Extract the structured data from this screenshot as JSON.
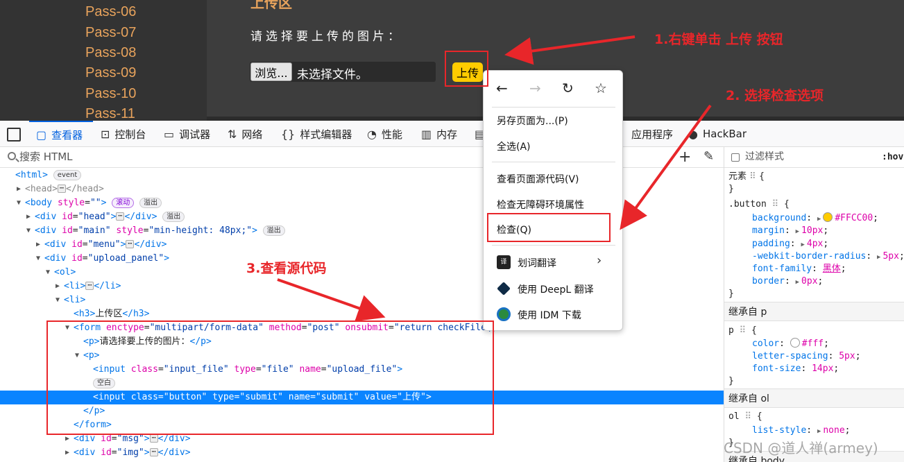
{
  "page": {
    "menu_items": [
      "Pass-06",
      "Pass-07",
      "Pass-08",
      "Pass-09",
      "Pass-10",
      "Pass-11"
    ],
    "section_title": "上传区",
    "prompt": "请选择要上传的图片：",
    "browse_label": "浏览...",
    "no_file_label": "未选择文件。",
    "upload_label": "上传"
  },
  "toolbar": {
    "tabs": [
      {
        "label": "查看器",
        "icon": "inspector-icon"
      },
      {
        "label": "控制台",
        "icon": "console-icon"
      },
      {
        "label": "调试器",
        "icon": "debugger-icon"
      },
      {
        "label": "网络",
        "icon": "network-icon"
      },
      {
        "label": "样式编辑器",
        "icon": "style-editor-icon"
      },
      {
        "label": "性能",
        "icon": "performance-icon"
      },
      {
        "label": "内存",
        "icon": "memory-icon"
      },
      {
        "label": "应用程序",
        "icon": "application-icon"
      },
      {
        "label": "HackBar",
        "icon": "hackbar-icon"
      }
    ]
  },
  "search": {
    "placeholder": "搜索 HTML"
  },
  "tree": {
    "html_open": "<html>",
    "event": "event",
    "head": "<head>",
    "head_close": "</head>",
    "body_open": "<body ",
    "body_attr": "style",
    "body_val": "\"\"",
    "body_end": ">",
    "scroll": "滚动",
    "overflow": "溢出",
    "div_head_open": "<div ",
    "div_head_attr": "id",
    "div_head_val": "\"head\"",
    "div_head_end": ">",
    "div_close": "</div>",
    "div_main_open": "<div ",
    "div_main_attr1": "id",
    "div_main_val1": "\"main\"",
    "div_main_attr2": "style",
    "div_main_val2": "\"min-height: 48px;\"",
    "div_main_end": ">",
    "div_menu_open": "<div ",
    "div_menu_attr": "id",
    "div_menu_val": "\"menu\"",
    "div_menu_end": ">",
    "div_up_open": "<div ",
    "div_up_attr": "id",
    "div_up_val": "\"upload_panel\"",
    "div_up_end": ">",
    "ol": "<ol>",
    "li": "<li>",
    "li_close": "</li>",
    "h3_open": "<h3>",
    "h3_text": "上传区",
    "h3_close": "</h3>",
    "form_open": "<form ",
    "form_a1": "enctype",
    "form_v1": "\"multipart/form-data\"",
    "form_a2": "method",
    "form_v2": "\"post\"",
    "form_a3": "onsubmit",
    "form_v3": "\"return checkFile()",
    "p_open": "<p>",
    "p_text": "请选择要上传的图片：",
    "p_close": "</p>",
    "p2_open": "<p>",
    "input1_open": "<input ",
    "input1_a1": "class",
    "input1_v1": "\"input_file\"",
    "input1_a2": "type",
    "input1_v2": "\"file\"",
    "input1_a3": "name",
    "input1_v3": "\"upload_file\"",
    "input1_end": ">",
    "whitespace": "空白",
    "input2": "<input class=\"button\" type=\"submit\" name=\"submit\" value=\"上传\">",
    "p2_close": "</p>",
    "form_close": "</form>",
    "div_msg_open": "<div ",
    "div_msg_attr": "id",
    "div_msg_val": "\"msg\"",
    "div_msg_end": ">",
    "div_img_open": "<div ",
    "div_img_attr": "id",
    "div_img_val": "\"img\"",
    "div_img_end": ">"
  },
  "rules": {
    "filter_placeholder": "过滤样式",
    "hov": ":hov",
    "element_selector": "元素",
    "button_selector": ".button",
    "button_props": [
      {
        "name": "background",
        "value": "#FFCC00",
        "swatch": "#FFCC00"
      },
      {
        "name": "margin",
        "value": "10px"
      },
      {
        "name": "padding",
        "value": "4px"
      },
      {
        "name": "-webkit-border-radius",
        "value": "5px"
      },
      {
        "name": "font-family",
        "value": "黑体"
      },
      {
        "name": "border",
        "value": "0px"
      }
    ],
    "inherit_p": "继承自 p",
    "p_selector": "p",
    "p_props": [
      {
        "name": "color",
        "value": "#fff",
        "swatch": "#ffffff"
      },
      {
        "name": "letter-spacing",
        "value": "5px"
      },
      {
        "name": "font-size",
        "value": "14px"
      }
    ],
    "inherit_ol": "继承自 ol",
    "ol_selector": "ol",
    "ol_props": [
      {
        "name": "list-style",
        "value": "none"
      }
    ],
    "inherit_body": "继承自 body"
  },
  "context_menu": {
    "items": [
      "另存页面为...(P)",
      "全选(A)",
      "查看页面源代码(V)",
      "检查无障碍环境属性",
      "检查(Q)",
      "划词翻译",
      "使用 DeepL 翻译",
      "使用 IDM 下载"
    ]
  },
  "annotations": {
    "step1": "1.右键单击 上传 按钮",
    "step2": "2. 选择检查选项",
    "step3": "3.查看源代码",
    "color": "#e8262a"
  },
  "watermark": "CSDN @道人禅(armey)"
}
